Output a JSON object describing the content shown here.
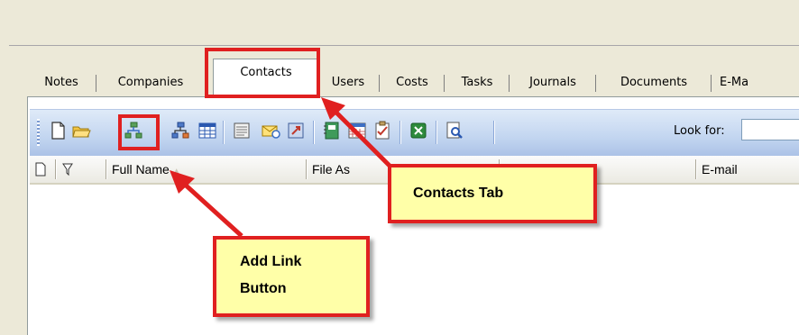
{
  "tabs": [
    {
      "label": "Notes"
    },
    {
      "label": "Companies"
    },
    {
      "label": "Contacts"
    },
    {
      "label": "Users"
    },
    {
      "label": "Costs"
    },
    {
      "label": "Tasks"
    },
    {
      "label": "Journals"
    },
    {
      "label": "Documents"
    },
    {
      "label": "E-Ma"
    }
  ],
  "active_tab": "Contacts",
  "toolbar": {
    "icons": [
      "new-icon",
      "open-folder-icon",
      "add-link-icon",
      "link-icon",
      "table-icon",
      "card-icon",
      "mail-icon",
      "export-icon",
      "contact-book-icon",
      "calendar-icon",
      "task-icon",
      "excel-icon",
      "find-icon"
    ],
    "look_for_label": "Look for:",
    "look_for_value": ""
  },
  "grid": {
    "columns": [
      {
        "label": ""
      },
      {
        "label": ""
      },
      {
        "label": "Full Name"
      },
      {
        "label": "File As"
      },
      {
        "label": ""
      },
      {
        "label": "E-mail"
      }
    ],
    "sort_indicator": "▲"
  },
  "callouts": {
    "contacts_tab": "Contacts Tab",
    "add_link_line1": "Add Link",
    "add_link_line2": "Button"
  },
  "colors": {
    "annotation_red": "#e02020",
    "callout_fill": "#ffffa8",
    "toolbar_blue": "#c2d5f0"
  }
}
